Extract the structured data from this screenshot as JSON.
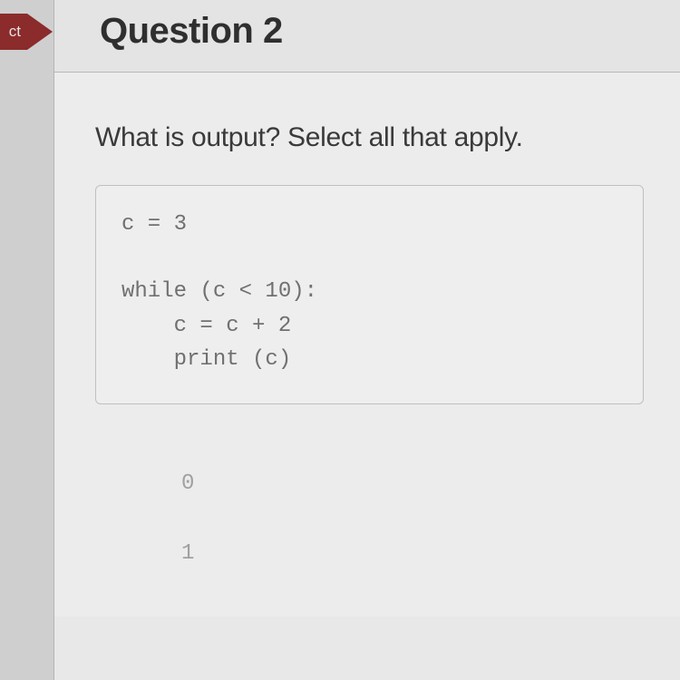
{
  "badge": {
    "text": "ct"
  },
  "header": {
    "title": "Question 2"
  },
  "question": {
    "prompt": "What is output? Select all that apply."
  },
  "code": {
    "line1": "c = 3",
    "line2": "",
    "line3": "while (c < 10):",
    "line4": "    c = c + 2",
    "line5": "    print (c)"
  },
  "options": {
    "opt0": "0",
    "opt1": "1"
  }
}
